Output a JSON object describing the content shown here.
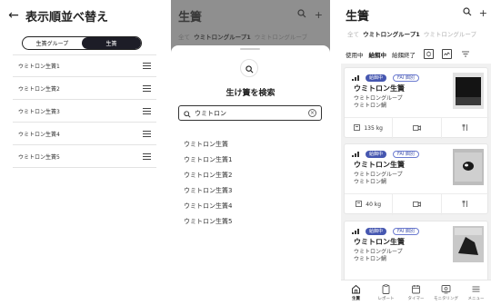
{
  "reorder_screen": {
    "title": "表示順並べ替え",
    "segments": [
      "生簀グループ",
      "生簀"
    ],
    "active_segment": 1,
    "items": [
      "ウミトロン生簀1",
      "ウミトロン生簀2",
      "ウミトロン生簀3",
      "ウミトロン生簀4",
      "ウミトロン生簀5"
    ]
  },
  "search_screen": {
    "title": "生簀",
    "tabs_text": "全て",
    "tabs_active": "ウミトロングループ1",
    "tabs_more": "ウミトロングルーブ",
    "sheet_title": "生け簀を検索",
    "query": "ウミトロン",
    "results": [
      "ウミトロン生簀",
      "ウミトロン生簀1",
      "ウミトロン生簀2",
      "ウミトロン生簀3",
      "ウミトロン生簀4",
      "ウミトロン生簀5"
    ]
  },
  "list_screen": {
    "title": "生簀",
    "tab_all": "全て",
    "tab_active": "ウミトロングループ1",
    "tab_more": "ウミトロングループ",
    "filters": [
      "使用中",
      "給餌中",
      "給餌終了"
    ],
    "active_filter": 1,
    "cards": [
      {
        "status": "給餌中",
        "tag": "FAI 餌別",
        "name": "ウミトロン生簀",
        "group": "ウミトロングループ",
        "species": "ウミトロン鯛",
        "amount": "135 kg",
        "camera": "",
        "feed": ""
      },
      {
        "status": "給餌中",
        "tag": "FAI 餌別",
        "name": "ウミトロン生簀",
        "group": "ウミトロングループ",
        "species": "ウミトロン鯛",
        "amount": "40 kg",
        "camera": "",
        "feed": ""
      },
      {
        "status": "給餌中",
        "tag": "FAI 餌別",
        "name": "ウミトロン生簀",
        "group": "ウミトロングループ",
        "species": "ウミトロン鯛",
        "amount": "",
        "camera": "",
        "feed": ""
      }
    ],
    "nav": [
      {
        "label": "生簀",
        "icon": "home-icon"
      },
      {
        "label": "レポート",
        "icon": "clipboard-icon"
      },
      {
        "label": "タイマー",
        "icon": "calendar-icon"
      },
      {
        "label": "モニタリング",
        "icon": "monitor-icon"
      },
      {
        "label": "メニュー",
        "icon": "menu-icon"
      }
    ],
    "active_nav": 0
  },
  "colors": {
    "accent": "#4657b0",
    "dark": "#1d1d27",
    "overlay": "#8f8f8f",
    "bg": "#f1f1f1"
  }
}
